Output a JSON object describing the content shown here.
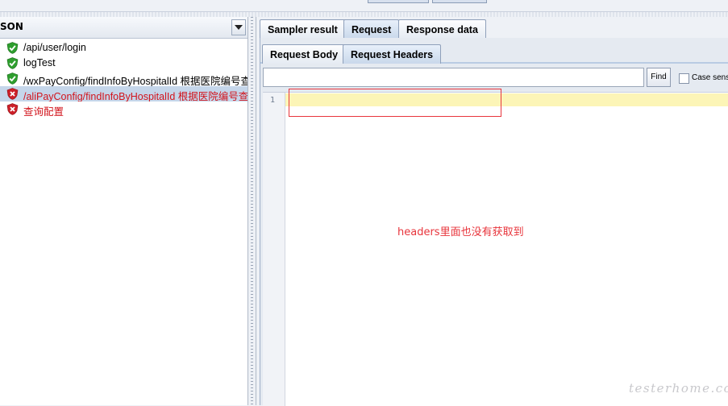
{
  "left_panel": {
    "header_label": "SON",
    "items": [
      {
        "label": "/api/user/login",
        "status": "success"
      },
      {
        "label": "logTest",
        "status": "success"
      },
      {
        "label": "/wxPayConfig/findInfoByHospitalId 根据医院编号查询",
        "status": "success"
      },
      {
        "label": "/aliPayConfig/findInfoByHospitalId 根据医院编号查询",
        "status": "failure",
        "selected": true
      },
      {
        "label": "查询配置",
        "status": "failure"
      }
    ]
  },
  "tabs": [
    "Sampler result",
    "Request",
    "Response data"
  ],
  "active_tab": "Request",
  "sub_tabs": [
    "Request Body",
    "Request Headers"
  ],
  "active_sub_tab": "Request Headers",
  "search": {
    "value": "",
    "find_label": "Find",
    "case_label": "Case sens"
  },
  "editor": {
    "line_number": "1",
    "content": ""
  },
  "annotation": {
    "text": "headers里面也没有获取到"
  },
  "watermark": "testerhome.com",
  "colors": {
    "success": "#2e9e2e",
    "failure": "#cc1f28",
    "annotation": "#e8353c",
    "selection": "#c5d6ea"
  }
}
